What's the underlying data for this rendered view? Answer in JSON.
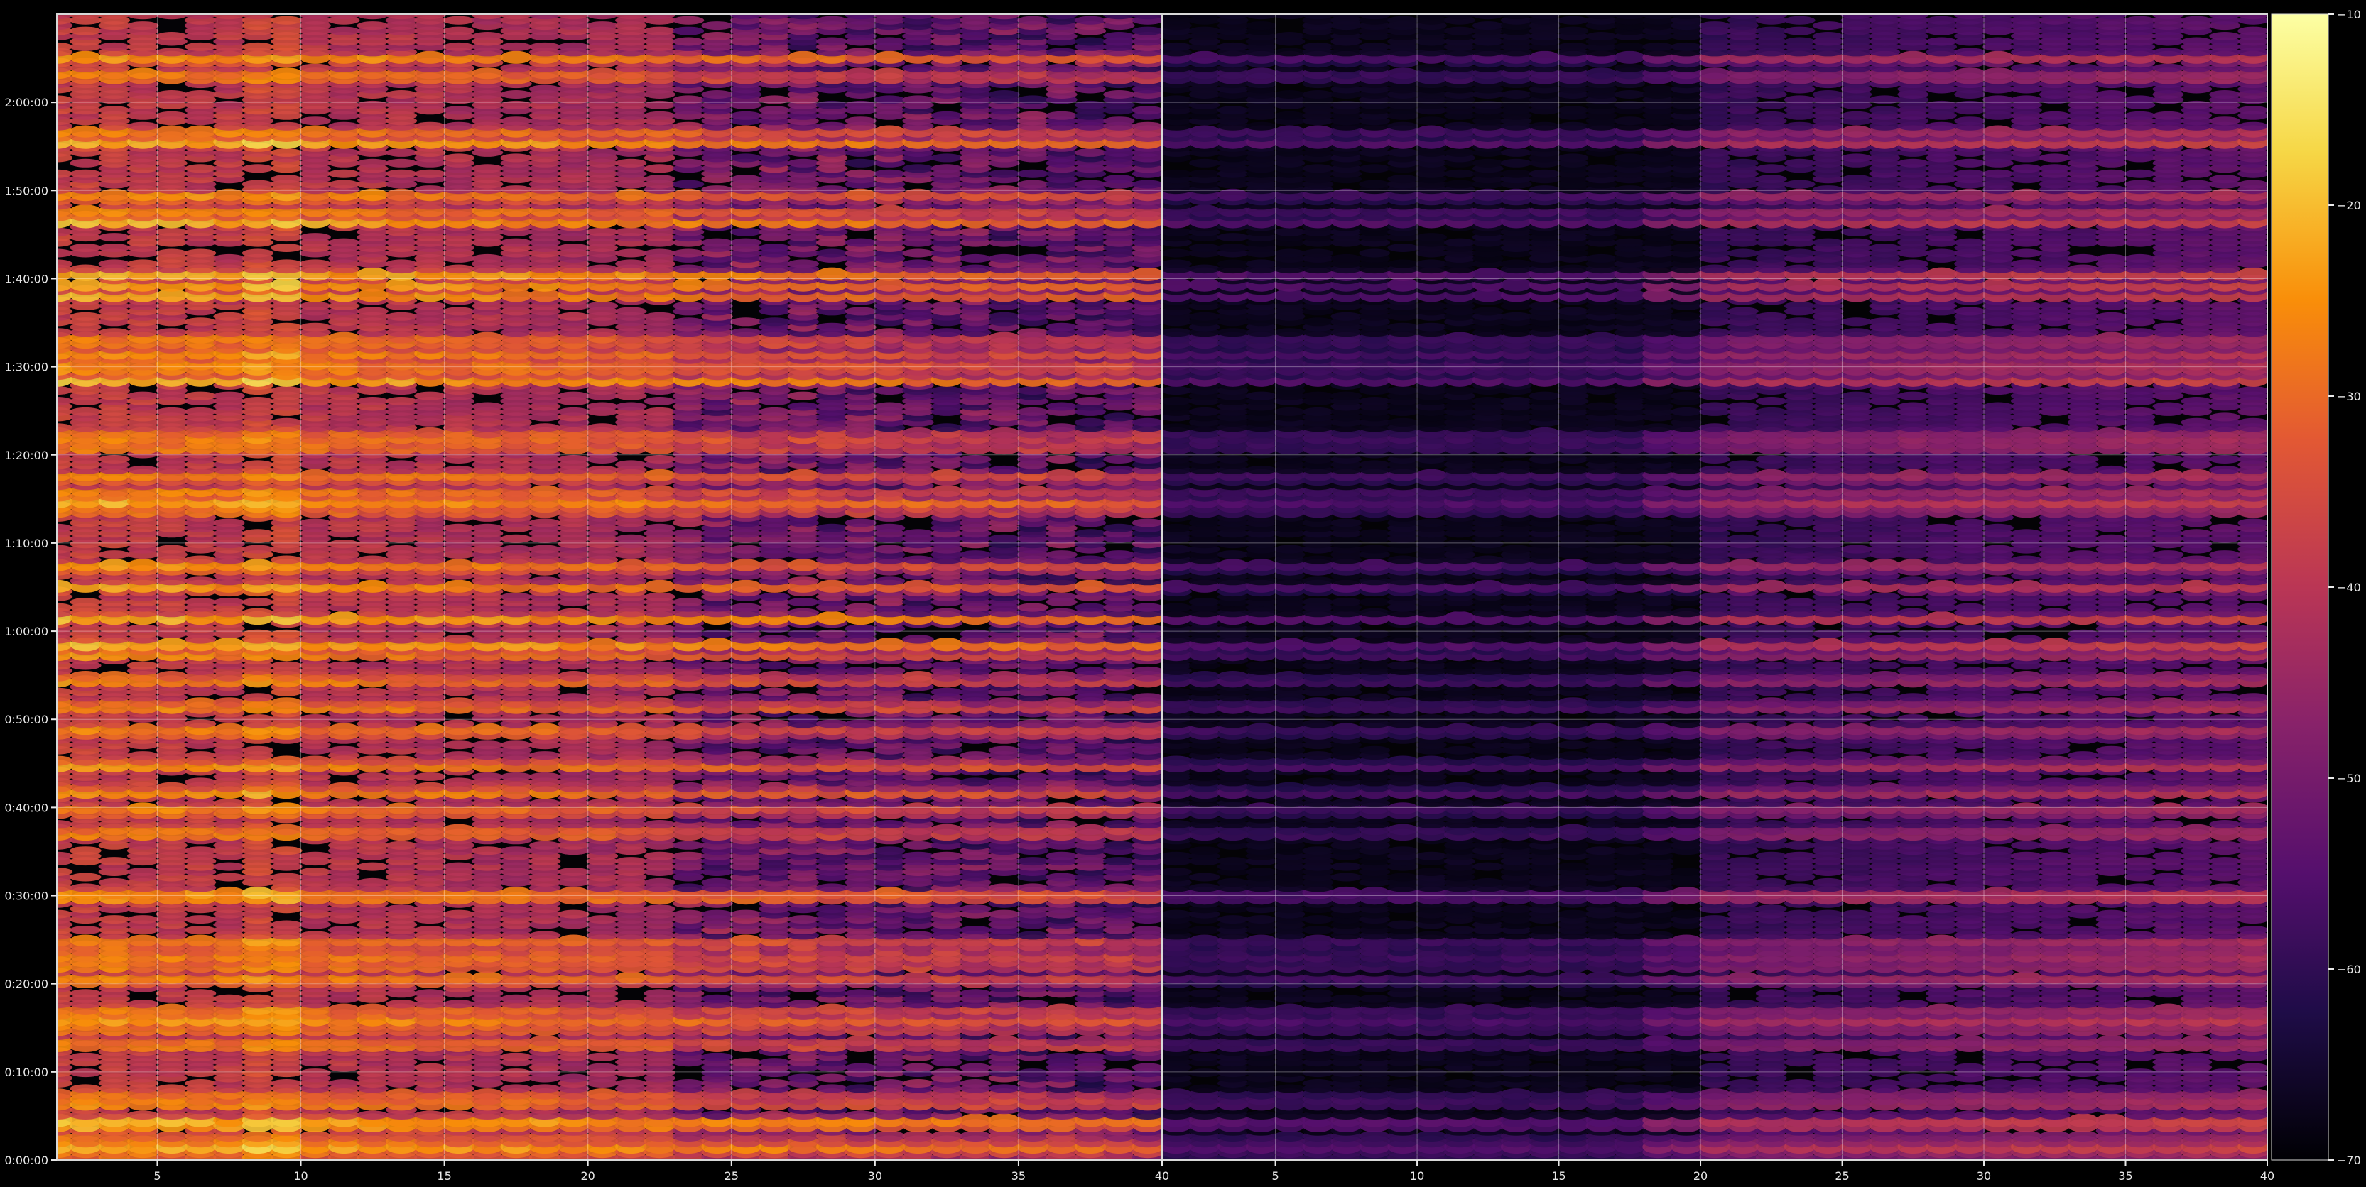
{
  "chart_data": {
    "type": "heatmap",
    "title": "",
    "xlabel": "",
    "ylabel": "",
    "colormap": "inferno",
    "panels": [
      {
        "name": "",
        "xlim": [
          1.5,
          40
        ],
        "x_ticks": [
          5,
          10,
          15,
          20,
          25,
          30,
          35,
          40
        ],
        "x_tick_labels": [
          "5",
          "10",
          "15",
          "20",
          "25",
          "30",
          "35",
          "40"
        ],
        "intensity": "high"
      },
      {
        "name": "",
        "xlim": [
          1,
          40
        ],
        "x_ticks": [
          5,
          10,
          15,
          20,
          25,
          30,
          35,
          40
        ],
        "x_tick_labels": [
          "5",
          "10",
          "15",
          "20",
          "25",
          "30",
          "35",
          "40"
        ],
        "intensity": "low"
      }
    ],
    "y_axis": {
      "range_seconds": [
        0,
        7800
      ],
      "ticks_seconds": [
        0,
        600,
        1200,
        1800,
        2400,
        3000,
        3600,
        4200,
        4800,
        5400,
        6000,
        6600,
        7200
      ],
      "tick_labels": [
        "0:00:00",
        "0:10:00",
        "0:20:00",
        "0:30:00",
        "0:40:00",
        "0:50:00",
        "1:00:00",
        "1:10:00",
        "1:20:00",
        "1:30:00",
        "1:40:00",
        "1:50:00",
        "2:00:00"
      ]
    },
    "colorbar": {
      "range": [
        -70,
        -10
      ],
      "ticks": [
        -10,
        -20,
        -30,
        -40,
        -50,
        -60,
        -70
      ],
      "tick_labels": [
        "−10",
        "−20",
        "−30",
        "−40",
        "−50",
        "−60",
        "−70"
      ]
    },
    "grid": true,
    "hot_bands_seconds": [
      7500,
      7380,
      6990,
      6930,
      6560,
      6450,
      6390,
      6030,
      5960,
      5890,
      5580,
      5500,
      5430,
      5370,
      5310,
      4930,
      4860,
      4650,
      4540,
      4480,
      4430,
      4040,
      3900,
      3690,
      3510,
      3450,
      3270,
      3090,
      2920,
      2690,
      2510,
      2380,
      2230,
      1810,
      1790,
      1480,
      1400,
      1330,
      1230,
      1010,
      960,
      900,
      790,
      430,
      390,
      270,
      230,
      140,
      90,
      40
    ]
  }
}
